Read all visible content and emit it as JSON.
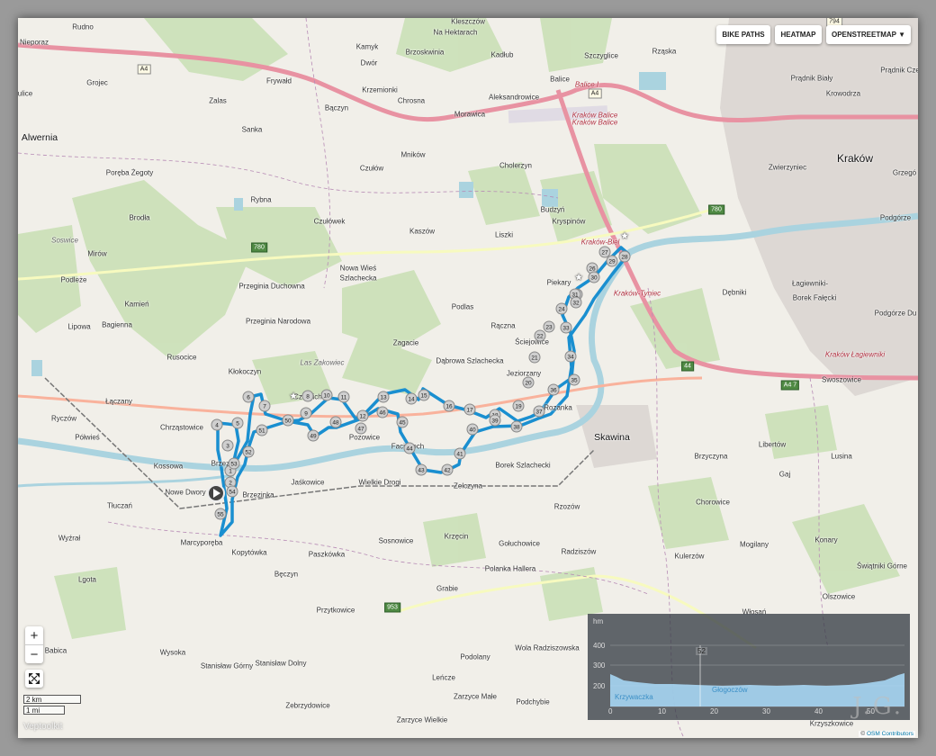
{
  "controls": {
    "bike_paths": "BIKE PATHS",
    "heatmap": "HEATMAP",
    "layer": "OPENSTREETMAP ▼",
    "zoom_in": "+",
    "zoom_out": "−"
  },
  "scale": {
    "km": "2 km",
    "mi": "1 mi"
  },
  "places": {
    "rudno": "Rudno",
    "nieporaz": "Nieporaz",
    "grojec": "Grojec",
    "ulice": "ulice",
    "alwernia": "Alwernia",
    "zalas": "Zalas",
    "frywald": "Frywałd",
    "sanka": "Sanka",
    "poreba": "Poręba Żegoty",
    "rybna": "Rybna",
    "brodla": "Brodła",
    "soswice": "Soswice",
    "mirow": "Mirów",
    "podleze": "Podleże",
    "kamien": "Kamień",
    "lipowa": "Lipowa",
    "bagienna": "Bagienna",
    "rusocice": "Rusocice",
    "klokoczyn": "Kłokoczyn",
    "laczany": "Łączany",
    "chrzastowice": "Chrząstowice",
    "ryczow": "Ryczów",
    "polwies": "Półwieś",
    "kossowa": "Kossowa",
    "brzezie": "Brzezie",
    "nowe_dwory": "Nowe Dwory",
    "brzezinka": "Brzezinka",
    "tlucza": "Tłuczań",
    "wyzral": "Wyźrał",
    "marcyporeba": "Marcyporęba",
    "kopytowka": "Kopytówka",
    "paszkowka": "Paszkówka",
    "becz": "Bęczyn",
    "lgota": "Lgota",
    "przytkowice": "Przytkowice",
    "babica": "Babica",
    "wysoka": "Wysoka",
    "stan_gorny": "Stanisław Górny",
    "stan_dolny": "Stanisław Dolny",
    "zebrzydowice": "Zebrzydowice",
    "kleszczow": "Kleszczów",
    "na_hektarach": "Na Hektarach",
    "kamyk": "Kamyk",
    "brzoskwinia": "Brzoskwinia",
    "kadlub": "Kadłub",
    "szczyglice": "Szczyglice",
    "rzaska": "Rząska",
    "dwor": "Dwór",
    "krzemionki": "Krzemionki",
    "chrosna": "Chrosna",
    "aleksandrowice": "Aleksandrowice",
    "balice": "Balice",
    "morawica": "Morawica",
    "baczyn": "Bączyn",
    "czulow": "Czułów",
    "mnikow": "Mników",
    "cholerzyn": "Cholerzyn",
    "czulowek": "Czułówek",
    "kaszow": "Kaszów",
    "liszki": "Liszki",
    "budzyn": "Budzyń",
    "kryspinow": "Kryspinów",
    "przeginia_duch": "Przeginia Duchowna",
    "nowa_wies": "Nowa Wieś",
    "szlachecka": "Szlachecka",
    "przeginia_nar": "Przeginia Narodowa",
    "podlas": "Podlas",
    "zagacie": "Zagacie",
    "raczna": "Rączna",
    "dabrowa": "Dąbrowa Szlachecka",
    "scielnice": "Ściejowice",
    "jeziorzany": "Jeziorzany",
    "piekary": "Piekary",
    "las_zakowiec": "Las Zakowiec",
    "czernichow": "Czernichów",
    "pozowice": "Pozowice",
    "facimiech": "Facimiech",
    "rozanka": "Rozanka",
    "skawina": "Skawina",
    "borek": "Borek Szlachecki",
    "zelczyna": "Zelczyna",
    "wielkie_drogi": "Wielkie Drogi",
    "jaskowice": "Jaśkowice",
    "krzecin": "Krzęcin",
    "sosnowice": "Sosnowice",
    "golczowice": "Gołuchowice",
    "radziszow": "Radziszów",
    "polanka": "Polanka Hallera",
    "grabie": "Grabie",
    "rzozow": "Rzozów",
    "wola": "Wola Radziszowska",
    "podolany": "Podolany",
    "lencze": "Leńcze",
    "zarzyce_male": "Zarzyce Małe",
    "zarzyce_wielkie": "Zarzyce Wielkie",
    "podchybie": "Podchybie",
    "krakow": "Kraków",
    "pradnik_bialy": "Prądnik Biały",
    "pradnik_czerwony": "Prądnik Cze",
    "krowodrza": "Krowodrza",
    "zwierzyniec": "Zwierzyniec",
    "grzegorz": "Grzegó",
    "podgorze": "Podgórze",
    "debniki": "Dębniki",
    "lagiewniki": "Łagiewniki-",
    "borek_falecki": "Borek Fałęcki",
    "podgorze_du": "Podgórze Du",
    "swoszowice": "Swoszowice",
    "libertow": "Libertów",
    "lusina": "Lusina",
    "brzyczyna": "Brzyczyna",
    "gaj": "Gaj",
    "chorowice": "Chorowice",
    "kulerzow": "Kulerzów",
    "mogilany": "Mogilany",
    "konary": "Konary",
    "swiatniki": "Świątniki Górne",
    "olszowice": "Olszowice",
    "wlosan": "Włosań",
    "krzyszkowice": "Krzyszkowice"
  },
  "rail_labels": {
    "balice_i": "Balice I",
    "krakow_balice": "Kraków Balice",
    "krakow_balice2": "Kraków Balice",
    "krakow_bielany": "Kraków-Biel",
    "krakow_tyniec": "Kraków-Tyniec",
    "krakow_lagiewniki": "Kraków Łagiewniki"
  },
  "roads": {
    "a4": "A4",
    "a4b": "A4",
    "r780a": "780",
    "r780b": "780",
    "r794": "794",
    "r44": "44",
    "r953": "953",
    "a4_7": "A4\n7"
  },
  "waypoints": [
    "1",
    "2",
    "3",
    "4",
    "5",
    "6",
    "7",
    "8",
    "9",
    "10",
    "11",
    "12",
    "13",
    "14",
    "15",
    "16",
    "17",
    "18",
    "19",
    "20",
    "21",
    "22",
    "23",
    "24",
    "25",
    "26",
    "27",
    "28",
    "29",
    "30",
    "31",
    "32",
    "33",
    "34",
    "35",
    "36",
    "37",
    "38",
    "39",
    "40",
    "41",
    "42",
    "43",
    "44",
    "45",
    "46",
    "47",
    "48",
    "49",
    "50",
    "51",
    "52",
    "53",
    "54",
    "55"
  ],
  "elevation": {
    "y_ticks": [
      "400",
      "300",
      "200"
    ],
    "unit": "hm",
    "x_ticks": [
      "0",
      "10",
      "20",
      "30",
      "40",
      "50"
    ],
    "start_label": "Krzywaczka",
    "mid_label": "Głogoczów",
    "marker": "52"
  },
  "watermark": "J.G.",
  "attribution": {
    "text": "© ",
    "link": "OSM Contributors"
  },
  "brand": "Veptoolkit",
  "colors": {
    "route": "#1a8fd0",
    "motorway": "#e892a2",
    "trunk": "#f9b29c",
    "secondary": "#f7fabf",
    "river": "#aad3df",
    "forest": "#add19e"
  }
}
